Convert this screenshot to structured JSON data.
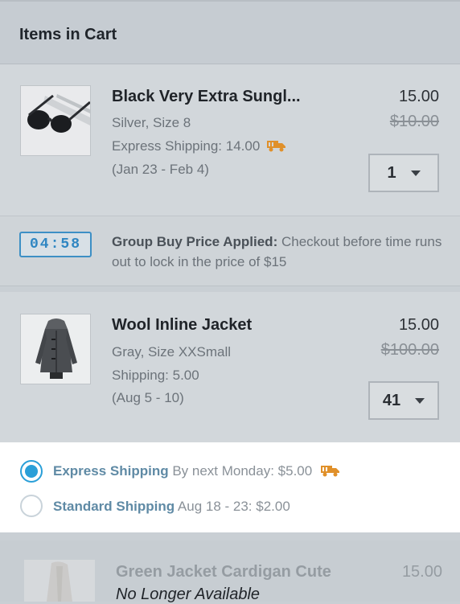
{
  "header": {
    "title": "Items in Cart"
  },
  "items": [
    {
      "name": "Black Very Extra Sungl...",
      "variant": "Silver, Size 8",
      "shipping": "Express Shipping:  14.00",
      "dates": "(Jan 23 - Feb 4)",
      "price": "15.00",
      "old_price": "$10.00",
      "qty": "1",
      "icon": "truck-icon"
    },
    {
      "name": "Wool Inline Jacket",
      "variant": "Gray, Size XXSmall",
      "shipping": "Shipping:  5.00",
      "dates": "(Aug 5 - 10)",
      "price": "15.00",
      "old_price": "$100.00",
      "qty": "41"
    }
  ],
  "group_buy": {
    "timer": "04:58",
    "label": "Group Buy Price Applied:",
    "text": " Checkout before time runs out to lock in the price of $15"
  },
  "shipping_options": [
    {
      "label": "Express Shipping",
      "detail": " By next Monday: $5.00",
      "selected": true,
      "icon": "truck-icon"
    },
    {
      "label": "Standard Shipping",
      "detail": " Aug 18 - 23:  $2.00",
      "selected": false
    }
  ],
  "unavailable_item": {
    "name": "Green Jacket Cardigan Cute",
    "status": "No Longer Available",
    "price": "15.00"
  },
  "colors": {
    "accent": "#2a9fd8",
    "truck": "#e0902a",
    "timer": "#2f86c2"
  }
}
